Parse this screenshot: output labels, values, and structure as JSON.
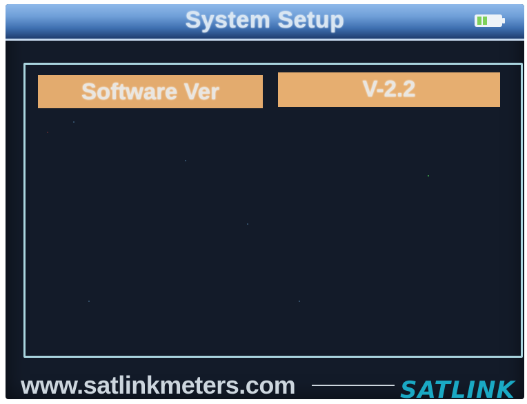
{
  "header": {
    "title": "System Setup",
    "battery_icon": "battery-icon"
  },
  "settings": {
    "rows": [
      {
        "label": "Software Ver",
        "value": "V-2.2"
      }
    ]
  },
  "footer": {
    "url": "www.satlinkmeters.com",
    "logo": "SATLINK"
  },
  "colors": {
    "screen_bg": "#131b29",
    "title_bar": "#6f9fd8",
    "panel_border": "#a9d4de",
    "field_bg": "#e3ab6e",
    "logo": "#1aa9c4",
    "battery_fill": "#7fd05a"
  }
}
